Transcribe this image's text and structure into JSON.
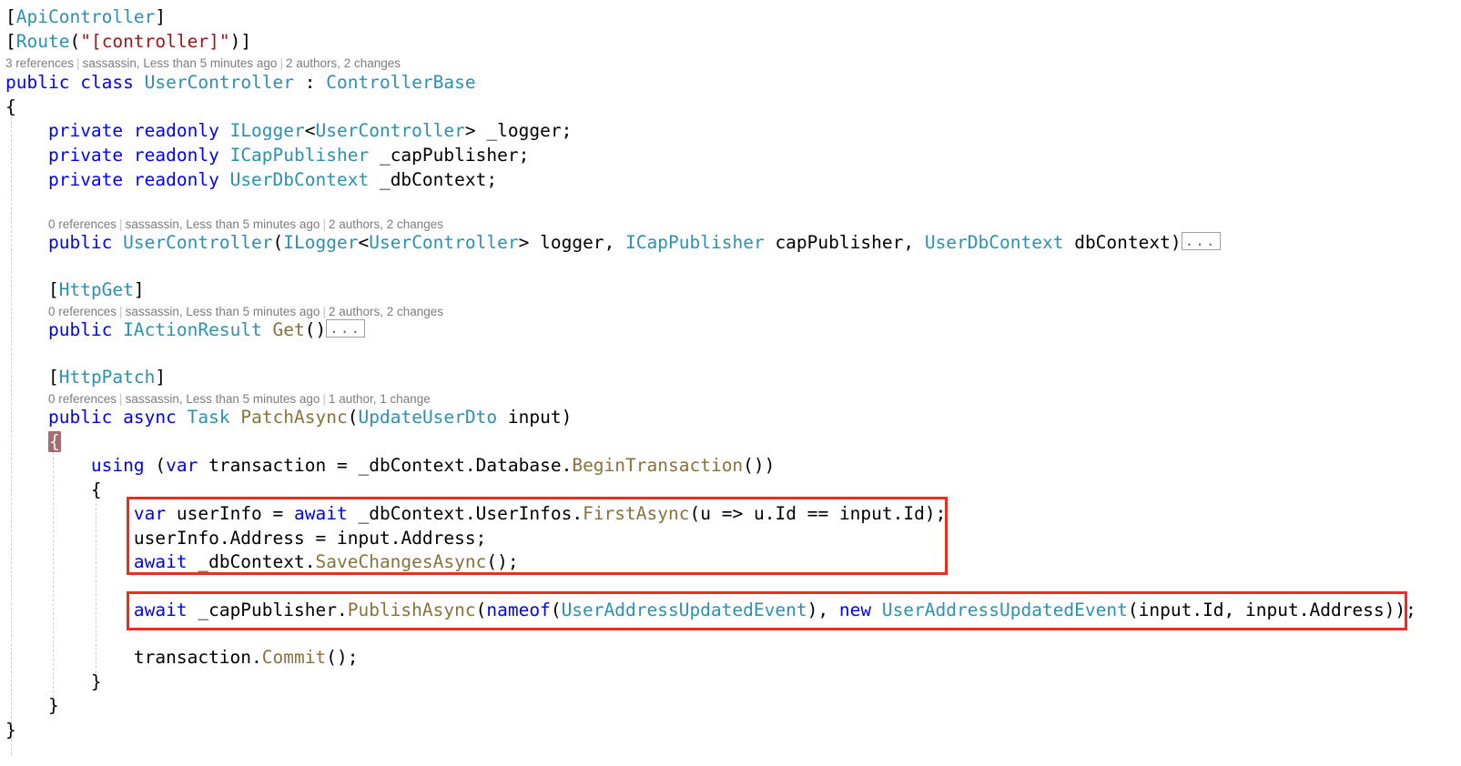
{
  "editor": {
    "language": "csharp",
    "theme": "visual-studio-light",
    "colors": {
      "background": "#ffffff",
      "keyword": "#0000ff",
      "type": "#2b91af",
      "string": "#a31515",
      "method": "#87723b",
      "plain_text": "#000000",
      "codelens_text": "#7d7d7d",
      "indent_guide": "#cfcfcf",
      "annotation_box": "#f02b20",
      "brace_highlight_bg": "#a36e73",
      "brace_highlight_fg": "#fdf6e3",
      "collapsed_border": "#a0a0a0"
    }
  },
  "code": {
    "l1": {
      "b1": "[",
      "attr": "ApiController",
      "b2": "]"
    },
    "l2": {
      "b1": "[",
      "attr": "Route",
      "p1": "(",
      "quote1": "\"",
      "route": "[controller]",
      "quote2": "\"",
      "p2": ")",
      "b2": "]"
    },
    "l3": {
      "kw_public": "public",
      "kw_class": "class",
      "class_name": "UserController",
      "colon": ":",
      "base_type": "ControllerBase"
    },
    "l4": {
      "brace": "{"
    },
    "l5": {
      "kw1": "private",
      "kw2": "readonly",
      "type": "ILogger",
      "generic_open": "<",
      "generic_arg": "UserController",
      "generic_close": ">",
      "field": "_logger",
      "semi": ";"
    },
    "l6": {
      "kw1": "private",
      "kw2": "readonly",
      "type": "ICapPublisher",
      "field": "_capPublisher",
      "semi": ";"
    },
    "l7": {
      "kw1": "private",
      "kw2": "readonly",
      "type": "UserDbContext",
      "field": "_dbContext",
      "semi": ";"
    },
    "l8": {
      "kw_public": "public",
      "ctor": "UserController",
      "open": "(",
      "p1_type": "ILogger",
      "p1_gopen": "<",
      "p1_garg": "UserController",
      "p1_gclose": ">",
      "p1_name": "logger",
      "comma1": ",",
      "p2_type": "ICapPublisher",
      "p2_name": "capPublisher",
      "comma2": ",",
      "p3_type": "UserDbContext",
      "p3_name": "dbContext",
      "close": ")",
      "collapsed": "..."
    },
    "l9": {
      "b1": "[",
      "attr": "HttpGet",
      "b2": "]"
    },
    "l10": {
      "kw_public": "public",
      "ret_type": "IActionResult",
      "method": "Get",
      "parens": "()",
      "collapsed": "..."
    },
    "l11": {
      "b1": "[",
      "attr": "HttpPatch",
      "b2": "]"
    },
    "l12": {
      "kw_public": "public",
      "kw_async": "async",
      "ret_type": "Task",
      "method": "PatchAsync",
      "open": "(",
      "p1_type": "UpdateUserDto",
      "p1_name": "input",
      "close": ")"
    },
    "l13": {
      "brace_highlighted": "{"
    },
    "l14": {
      "kw_using": "using",
      "open": "(",
      "kw_var": "var",
      "name": "transaction",
      "eq": "=",
      "obj": "_dbContext",
      "dot1": ".",
      "prop": "Database",
      "dot2": ".",
      "method": "BeginTransaction",
      "close": "())"
    },
    "l15": {
      "brace": "{"
    },
    "l16": {
      "kw_var": "var",
      "name": "userInfo",
      "eq": "=",
      "kw_await": "await",
      "obj": "_dbContext",
      "dot1": ".",
      "prop": "UserInfos",
      "dot2": ".",
      "method": "FirstAsync",
      "open": "(",
      "lambda_param": "u",
      "arrow": "=>",
      "lambda_obj": "u",
      "dot3": ".",
      "lambda_prop": "Id",
      "eqeq": "==",
      "rhs_obj": "input",
      "dot4": ".",
      "rhs_prop": "Id",
      "close": ");"
    },
    "l17": {
      "obj": "userInfo",
      "dot1": ".",
      "prop": "Address",
      "eq": "=",
      "rhs_obj": "input",
      "dot2": ".",
      "rhs_prop": "Address",
      "semi": ";"
    },
    "l18": {
      "kw_await": "await",
      "obj": "_dbContext",
      "dot": ".",
      "method": "SaveChangesAsync",
      "close": "();"
    },
    "l19": {
      "kw_await": "await",
      "obj": "_capPublisher",
      "dot1": ".",
      "method": "PublishAsync",
      "open": "(",
      "kw_nameof": "nameof",
      "nameof_open": "(",
      "event_type": "UserAddressUpdatedEvent",
      "nameof_close": ")",
      "comma": ",",
      "kw_new": "new",
      "new_type": "UserAddressUpdatedEvent",
      "new_open": "(",
      "a1_obj": "input",
      "a1_dot": ".",
      "a1_prop": "Id",
      "arg_comma": ",",
      "a2_obj": "input",
      "a2_dot": ".",
      "a2_prop": "Address",
      "close": "));"
    },
    "l20": {
      "obj": "transaction",
      "dot": ".",
      "method": "Commit",
      "close": "();"
    },
    "l21": {
      "brace": "}"
    },
    "l22": {
      "brace": "}"
    },
    "l23": {
      "brace": "}"
    }
  },
  "codelens": {
    "class": {
      "references": "3 references",
      "author": "sassassin, Less than 5 minutes ago",
      "changes": "2 authors, 2 changes"
    },
    "constructor": {
      "references": "0 references",
      "author": "sassassin, Less than 5 minutes ago",
      "changes": "2 authors, 2 changes"
    },
    "get_method": {
      "references": "0 references",
      "author": "sassassin, Less than 5 minutes ago",
      "changes": "2 authors, 2 changes"
    },
    "patch_method": {
      "references": "0 references",
      "author": "sassassin, Less than 5 minutes ago",
      "changes": "1 author, 1 change"
    }
  },
  "annotations": {
    "box_1_label": "db-update-block-highlight",
    "box_2_label": "publish-event-highlight"
  }
}
